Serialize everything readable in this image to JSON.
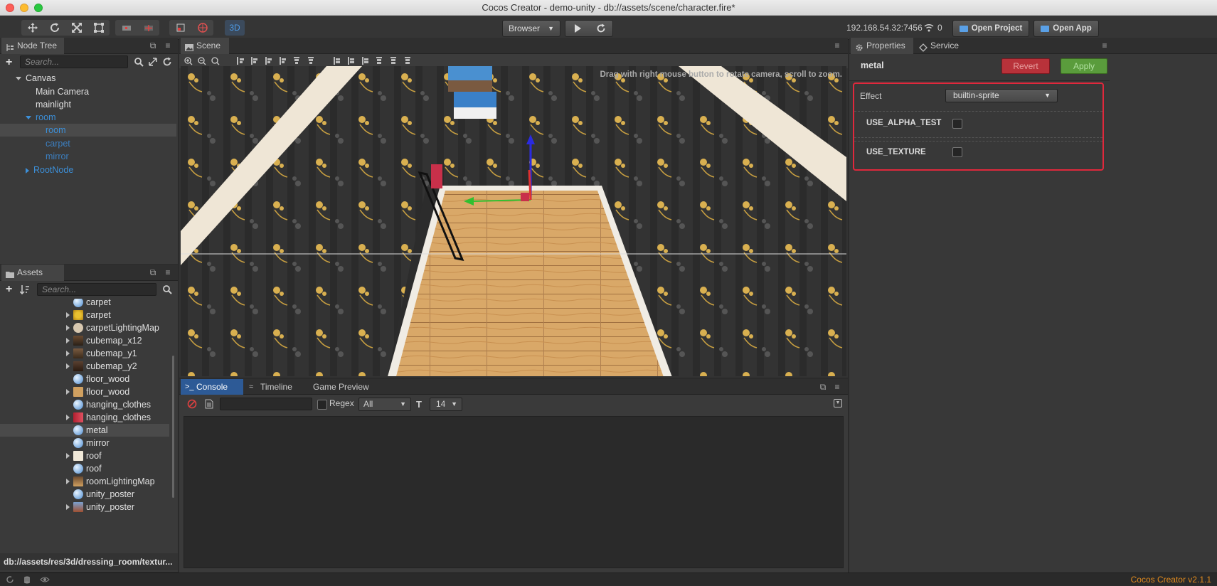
{
  "window": {
    "title": "Cocos Creator - demo-unity - db://assets/scene/character.fire*"
  },
  "toolbar": {
    "platform": "Browser",
    "mode3d": "3D",
    "ip": "192.168.54.32:7456",
    "devices": "0",
    "open_project": "Open Project",
    "open_app": "Open App"
  },
  "node_tree": {
    "tab": "Node Tree",
    "search_placeholder": "Search...",
    "items": [
      {
        "label": "Canvas"
      },
      {
        "label": "Main Camera"
      },
      {
        "label": "mainlight"
      },
      {
        "label": "room"
      },
      {
        "label": "room"
      },
      {
        "label": "carpet"
      },
      {
        "label": "mirror"
      },
      {
        "label": "RootNode"
      }
    ]
  },
  "assets": {
    "tab": "Assets",
    "search_placeholder": "Search...",
    "items": [
      {
        "label": "carpet",
        "icon": "material-icon"
      },
      {
        "label": "carpet",
        "icon": "texture-icon"
      },
      {
        "label": "carpetLightingMap",
        "icon": "lightmap-icon"
      },
      {
        "label": "cubemap_x12",
        "icon": "texture-icon"
      },
      {
        "label": "cubemap_y1",
        "icon": "texture-icon"
      },
      {
        "label": "cubemap_y2",
        "icon": "texture-icon"
      },
      {
        "label": "floor_wood",
        "icon": "material-icon"
      },
      {
        "label": "floor_wood",
        "icon": "texture-icon"
      },
      {
        "label": "hanging_clothes",
        "icon": "material-icon"
      },
      {
        "label": "hanging_clothes",
        "icon": "texture-icon"
      },
      {
        "label": "metal",
        "icon": "material-icon"
      },
      {
        "label": "mirror",
        "icon": "material-icon"
      },
      {
        "label": "roof",
        "icon": "texture-icon"
      },
      {
        "label": "roof",
        "icon": "material-icon"
      },
      {
        "label": "roomLightingMap",
        "icon": "texture-icon"
      },
      {
        "label": "unity_poster",
        "icon": "material-icon"
      },
      {
        "label": "unity_poster",
        "icon": "texture-icon"
      }
    ],
    "path": "db://assets/res/3d/dressing_room/textur..."
  },
  "scene": {
    "tab": "Scene",
    "hint": "Drag with right mouse button to rotate camera, scroll to zoom."
  },
  "console": {
    "tabs": [
      "Console",
      "Timeline",
      "Game Preview"
    ],
    "regex_label": "Regex",
    "level": "All",
    "font_size": "14"
  },
  "properties": {
    "tabs": [
      "Properties",
      "Service"
    ],
    "asset_name": "metal",
    "revert": "Revert",
    "apply": "Apply",
    "effect_label": "Effect",
    "effect_value": "builtin-sprite",
    "defines": [
      {
        "label": "USE_ALPHA_TEST",
        "checked": false
      },
      {
        "label": "USE_TEXTURE",
        "checked": false
      }
    ]
  },
  "status": {
    "version": "Cocos Creator v2.1.1"
  },
  "colors": {
    "accent_blue": "#3a6fb0",
    "tree_blue": "#3c8fd8",
    "revert_red": "#b8323a",
    "apply_green": "#5a9c3c",
    "highlight_red": "#e0283c",
    "version_orange": "#e08a1e"
  }
}
